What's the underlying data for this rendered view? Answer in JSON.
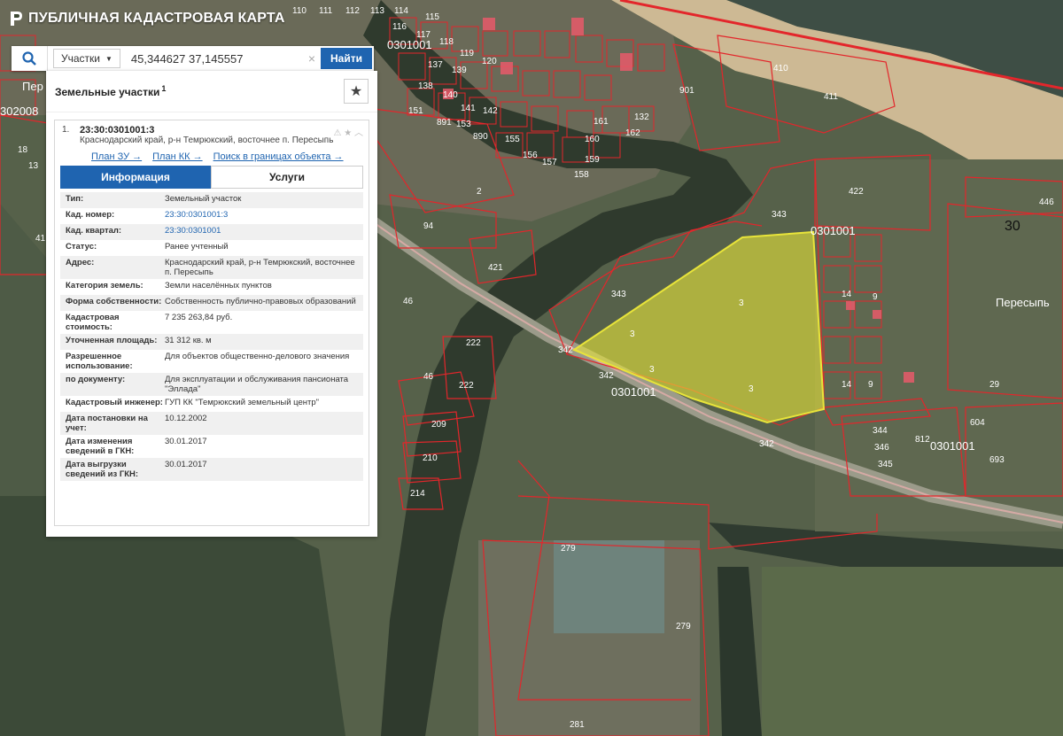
{
  "app": {
    "title": "ПУБЛИЧНАЯ КАДАСТРОВАЯ КАРТА"
  },
  "search": {
    "type_label": "Участки",
    "value": "45,344627 37,145557",
    "clear_icon": "×",
    "button_label": "Найти"
  },
  "panel": {
    "title": "Земельные участки",
    "count": "1",
    "result": {
      "index": "1.",
      "cad_number": "23:30:0301001:3",
      "address": "Краснодарский край, р-н Темрюкский, восточнее п. Пересыпь",
      "links": [
        "План ЗУ →",
        "План КК →",
        "Поиск в границах объекта →"
      ],
      "tabs": [
        "Информация",
        "Услуги"
      ],
      "rows": [
        {
          "k": "Тип:",
          "v": "Земельный участок"
        },
        {
          "k": "Кад. номер:",
          "v": "23:30:0301001:3",
          "link": true
        },
        {
          "k": "Кад. квартал:",
          "v": "23:30:0301001",
          "link": true
        },
        {
          "k": "Статус:",
          "v": "Ранее учтенный"
        },
        {
          "k": "Адрес:",
          "v": "Краснодарский край, р-н Темрюкский, восточнее п. Пересыпь"
        },
        {
          "k": "Категория земель:",
          "v": "Земли населённых пунктов"
        },
        {
          "k": "Форма собственности:",
          "v": "Собственность публично-правовых образований"
        },
        {
          "k": "Кадастровая стоимость:",
          "v": "7 235 263,84 руб."
        },
        {
          "k": "Уточненная площадь:",
          "v": "31 312 кв. м"
        },
        {
          "k": "Разрешенное использование:",
          "v": "Для объектов общественно-делового значения"
        },
        {
          "k": "по документу:",
          "v": "Для эксплуатации и обслуживания пансионата \"Эллада\""
        },
        {
          "k": "Кадастровый инженер:",
          "v": "ГУП КК \"Темрюкский земельный центр\""
        },
        {
          "k": "Дата постановки на учет:",
          "v": "10.12.2002"
        },
        {
          "k": "Дата изменения сведений в ГКН:",
          "v": "30.01.2017"
        },
        {
          "k": "Дата выгрузки сведений из ГКН:",
          "v": "30.01.2017"
        }
      ]
    }
  },
  "map": {
    "quarter_labels": [
      "0301001",
      "0301001",
      "0301001",
      "0301001",
      "0301001"
    ],
    "place_labels": [
      "Пересыпь",
      "Пер",
      "302008"
    ],
    "block_label": "30",
    "parcel_labels": [
      "410",
      "411",
      "901",
      "422",
      "343",
      "343",
      "421",
      "94",
      "2",
      "46",
      "46",
      "222",
      "222",
      "209",
      "210",
      "214",
      "342",
      "342",
      "342",
      "3",
      "3",
      "3",
      "3",
      "14",
      "14",
      "9",
      "9",
      "29",
      "344",
      "346",
      "345",
      "812",
      "693",
      "604",
      "446",
      "279",
      "279",
      "281",
      "161",
      "162",
      "132",
      "160",
      "159",
      "158",
      "157",
      "156",
      "155",
      "141",
      "142",
      "153",
      "890",
      "891",
      "151",
      "138",
      "137",
      "139",
      "140",
      "120",
      "119",
      "118",
      "117",
      "116",
      "115",
      "114",
      "113",
      "112",
      "111",
      "110",
      "41",
      "18",
      "13"
    ]
  },
  "colors": {
    "accent": "#1f64b0",
    "parcel_border": "#e3262b",
    "selected_fill": "#e8e43a",
    "sea": "#4a5b44",
    "river": "#2e3b2c",
    "beach": "#c9b48a"
  }
}
